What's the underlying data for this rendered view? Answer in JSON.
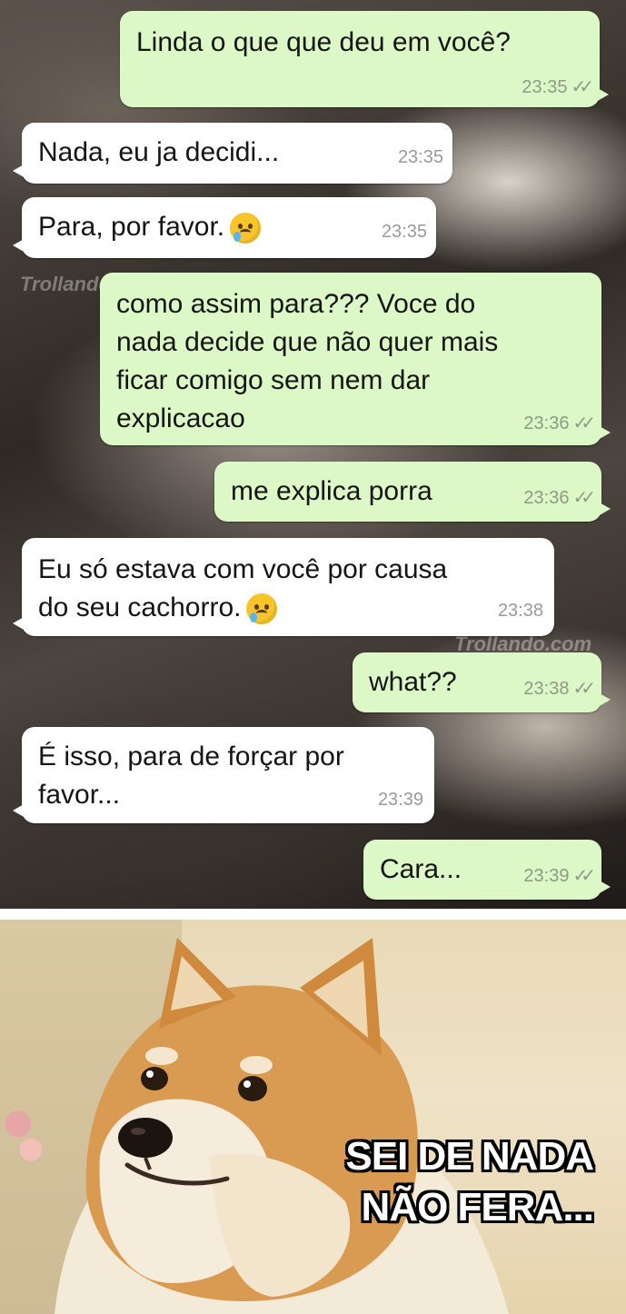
{
  "messages": [
    {
      "dir": "out",
      "lines": [
        "Linda o que que deu em você?"
      ],
      "time": "23:35",
      "ticks": "✓✓"
    },
    {
      "dir": "in",
      "lines": [
        "Nada, eu ja decidi..."
      ],
      "time": "23:35"
    },
    {
      "dir": "in",
      "lines": [
        "Para, por favor."
      ],
      "emoji": "crying-face-emoji",
      "time": "23:35"
    },
    {
      "dir": "out",
      "lines": [
        "como assim para??? Voce do",
        "nada decide que não quer mais",
        "ficar comigo sem nem dar",
        "explicacao"
      ],
      "time": "23:36",
      "ticks": "✓✓"
    },
    {
      "dir": "out",
      "lines": [
        "me explica porra"
      ],
      "time": "23:36",
      "ticks": "✓✓"
    },
    {
      "dir": "in",
      "lines": [
        "Eu só estava com você por causa",
        "do seu cachorro."
      ],
      "emoji": "sad-relieved-face-emoji",
      "time": "23:38"
    },
    {
      "dir": "out",
      "lines": [
        "what??"
      ],
      "time": "23:38",
      "ticks": "✓✓"
    },
    {
      "dir": "in",
      "lines": [
        "É isso, para de forçar por",
        "favor..."
      ],
      "time": "23:39"
    },
    {
      "dir": "out",
      "lines": [
        "Cara..."
      ],
      "time": "23:39",
      "ticks": "✓✓"
    }
  ],
  "watermark": "Trollando.com",
  "meme": {
    "caption_line1": "SEI DE NADA",
    "caption_line2": "NÃO FERA..."
  },
  "colors": {
    "outgoing_bubble": "#dcf8c6",
    "incoming_bubble": "#ffffff",
    "caption_text": "#ffffff",
    "caption_outline": "#000000"
  }
}
